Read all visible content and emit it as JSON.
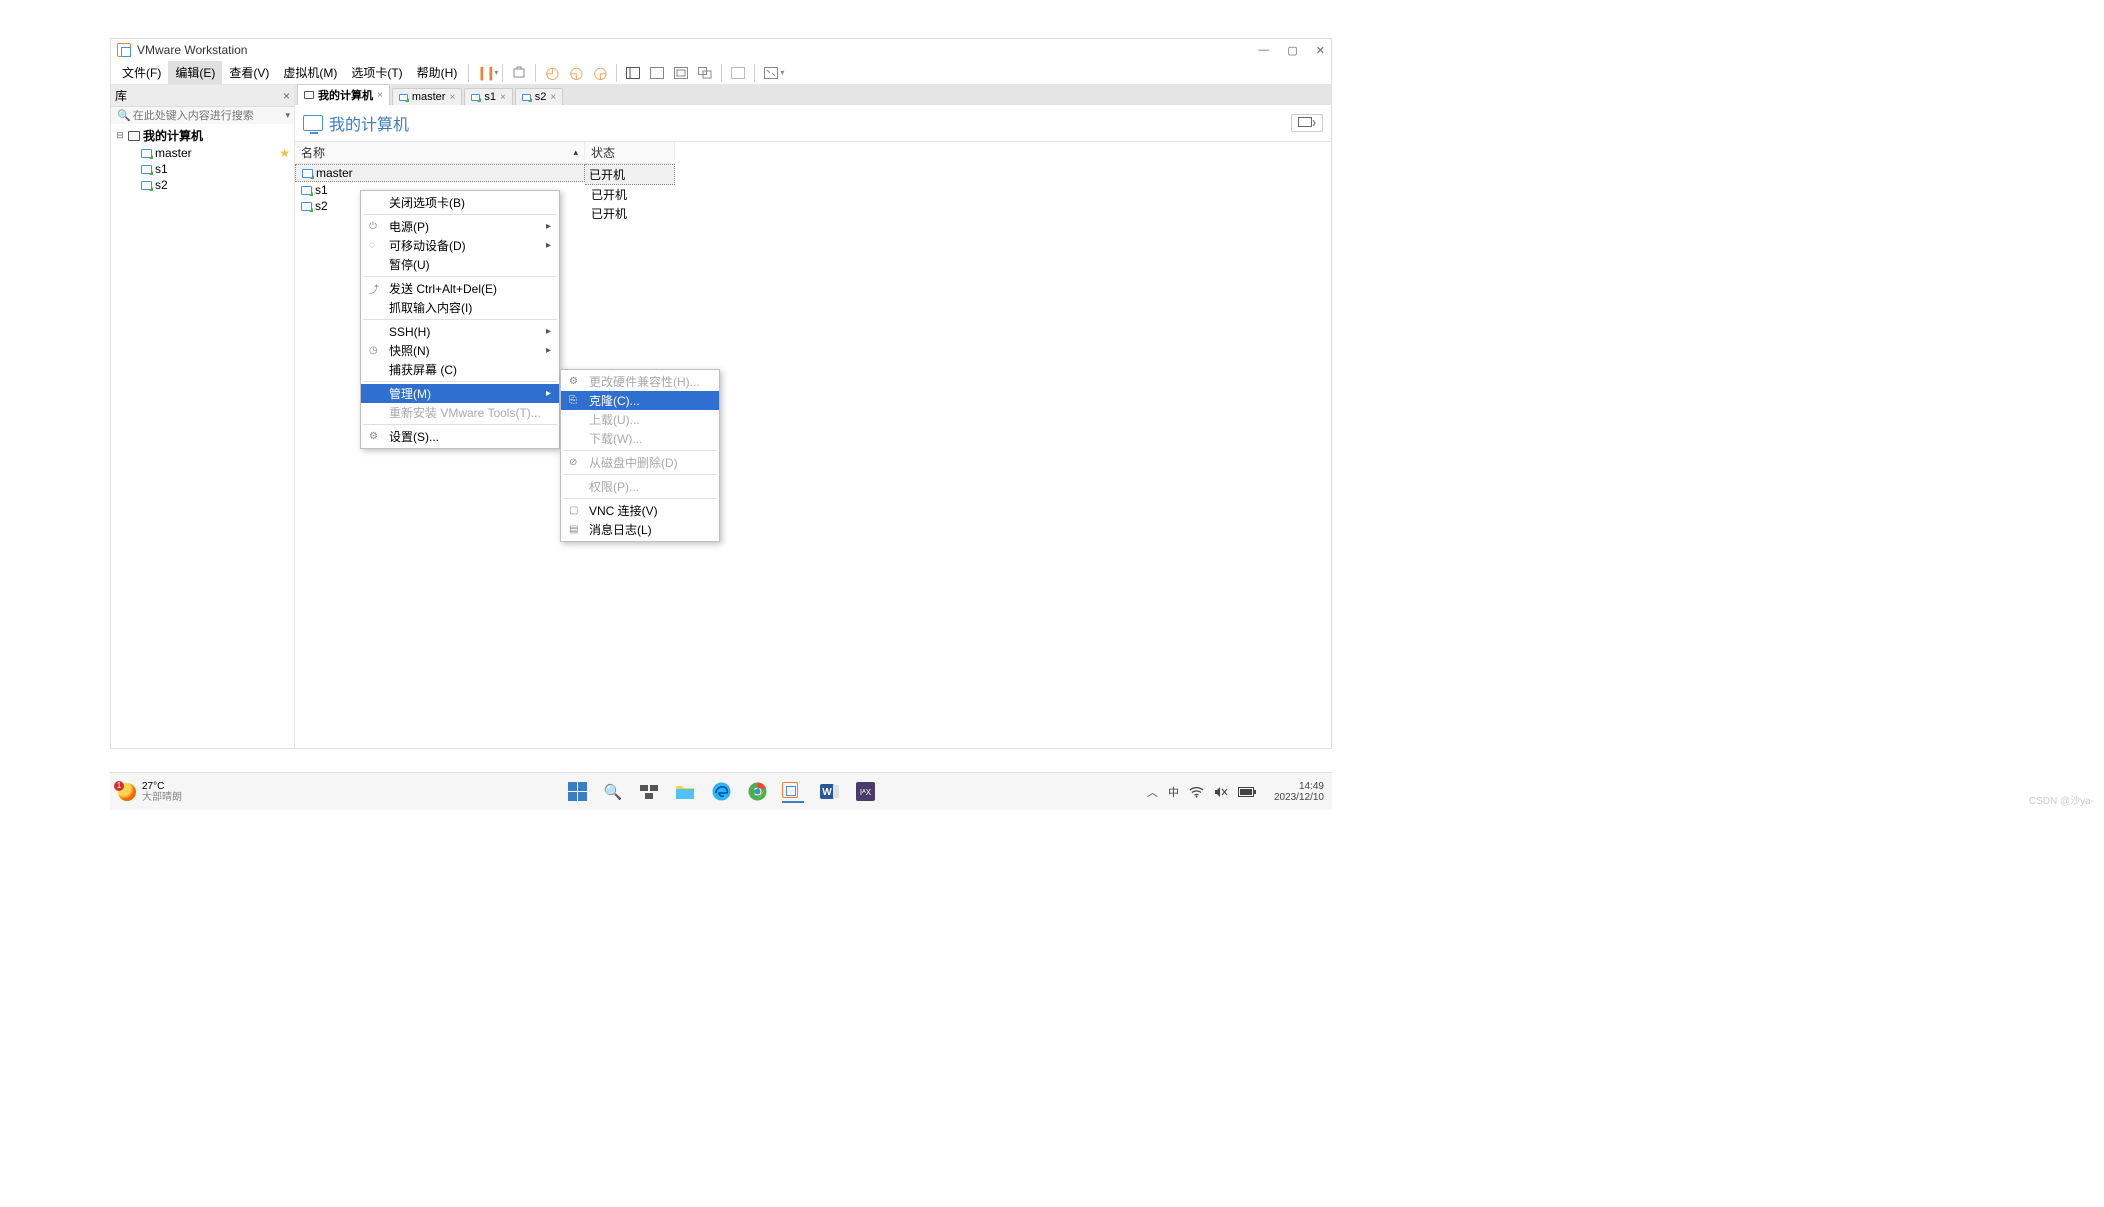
{
  "window": {
    "title": "VMware Workstation"
  },
  "menus": {
    "file": "文件(F)",
    "edit": "编辑(E)",
    "view": "查看(V)",
    "vm": "虚拟机(M)",
    "tabs": "选项卡(T)",
    "help": "帮助(H)"
  },
  "sidebar": {
    "title": "库",
    "search_placeholder": "在此处键入内容进行搜索",
    "root": "我的计算机",
    "items": [
      "master",
      "s1",
      "s2"
    ]
  },
  "tabs": [
    {
      "label": "我的计算机",
      "type": "home"
    },
    {
      "label": "master",
      "type": "vm"
    },
    {
      "label": "s1",
      "type": "vm"
    },
    {
      "label": "s2",
      "type": "vm"
    }
  ],
  "content": {
    "title": "我的计算机",
    "columns": {
      "name": "名称",
      "status": "状态"
    },
    "rows": [
      {
        "name": "master",
        "status": "已开机"
      },
      {
        "name": "s1",
        "status": "已开机"
      },
      {
        "name": "s2",
        "status": "已开机"
      }
    ]
  },
  "ctx1": {
    "close_tab": "关闭选项卡(B)",
    "power": "电源(P)",
    "removable": "可移动设备(D)",
    "pause": "暂停(U)",
    "send_cad": "发送 Ctrl+Alt+Del(E)",
    "grab_input": "抓取输入内容(I)",
    "ssh": "SSH(H)",
    "snapshot": "快照(N)",
    "capture": "捕获屏幕 (C)",
    "manage": "管理(M)",
    "reinstall_tools": "重新安装 VMware Tools(T)...",
    "settings": "设置(S)..."
  },
  "ctx2": {
    "change_hw": "更改硬件兼容性(H)...",
    "clone": "克隆(C)...",
    "upload": "上载(U)...",
    "download": "下载(W)...",
    "delete_disk": "从磁盘中删除(D)",
    "permissions": "权限(P)...",
    "vnc": "VNC 连接(V)",
    "msglog": "消息日志(L)"
  },
  "taskbar": {
    "weather": {
      "badge": "1",
      "temp": "27°C",
      "desc": "大部晴朗"
    },
    "ime": "中",
    "time": "14:49",
    "date": "2023/12/10"
  },
  "watermark": "CSDN @沙ya-"
}
